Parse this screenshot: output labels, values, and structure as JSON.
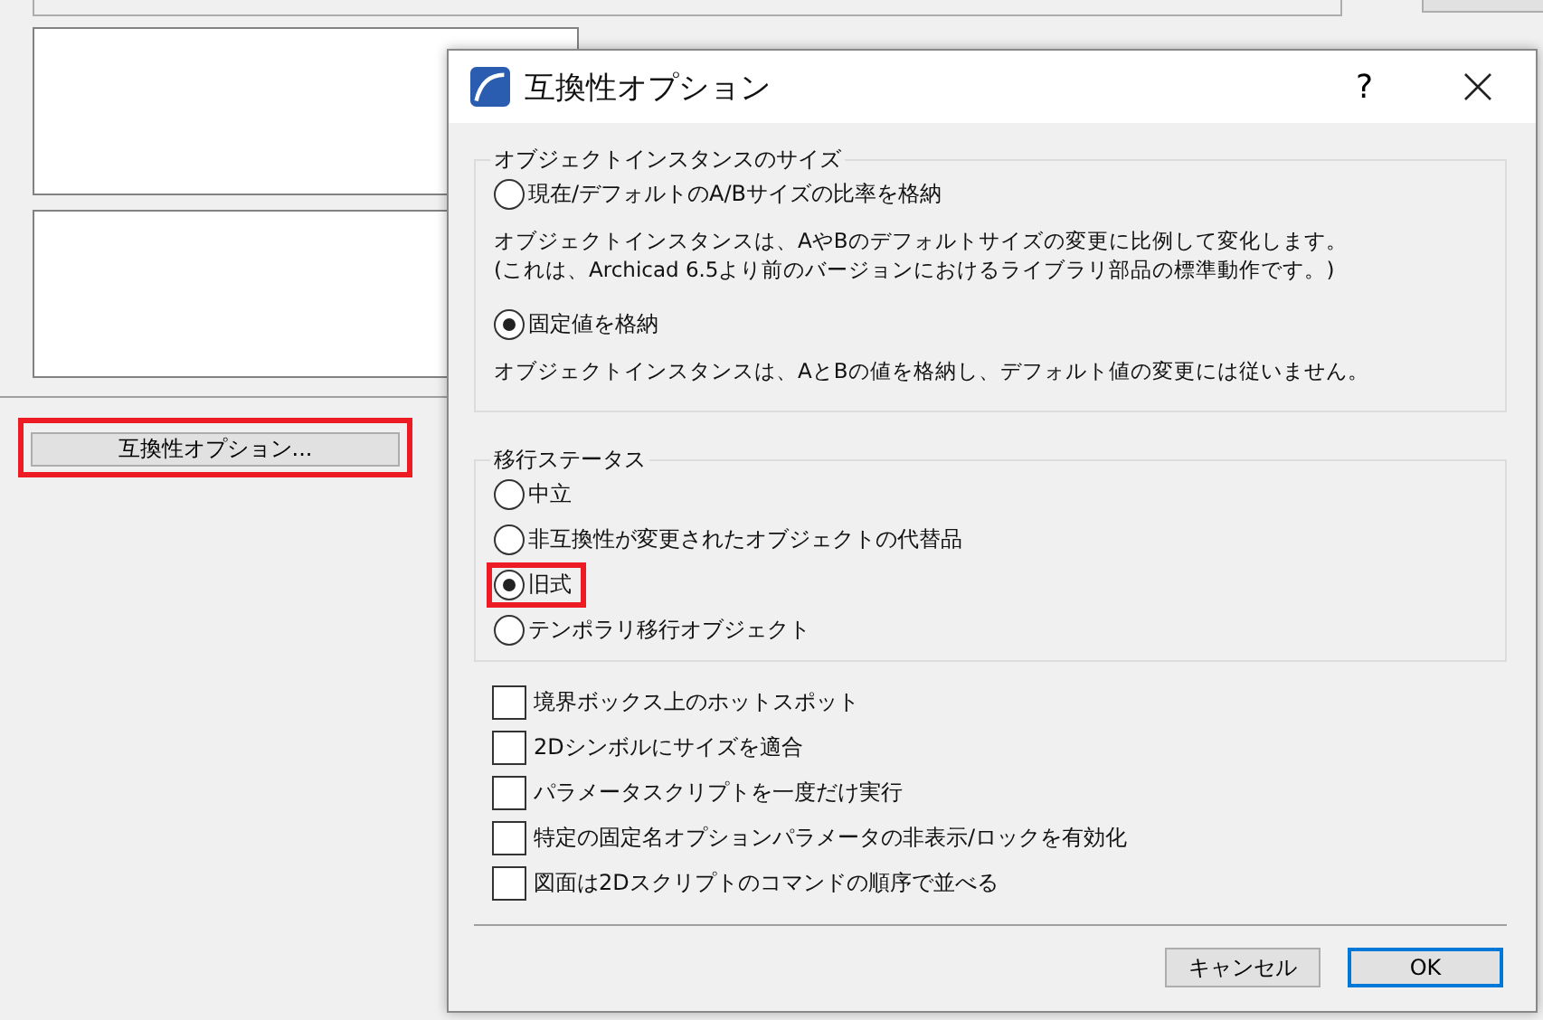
{
  "background": {
    "button": {
      "label": "互換性オプション...",
      "highlighted": true
    }
  },
  "dialog": {
    "title": "互換性オプション",
    "help": "?",
    "size_group": {
      "legend": "オブジェクトインスタンスのサイズ",
      "options": [
        {
          "label": "現在/デフォルトのA/Bサイズの比率を格納",
          "selected": false,
          "description": [
            "オブジェクトインスタンスは、AやBのデフォルトサイズの変更に比例して変化します。",
            "(これは、Archicad 6.5より前のバージョンにおけるライブラリ部品の標準動作です。)"
          ]
        },
        {
          "label": "固定値を格納",
          "selected": true,
          "description": [
            "オブジェクトインスタンスは、AとBの値を格納し、デフォルト値の変更には従いません。"
          ]
        }
      ]
    },
    "status_group": {
      "legend": "移行ステータス",
      "options": [
        {
          "label": "中立",
          "selected": false,
          "highlighted": false
        },
        {
          "label": "非互換性が変更されたオブジェクトの代替品",
          "selected": false,
          "highlighted": false
        },
        {
          "label": "旧式",
          "selected": true,
          "highlighted": true
        },
        {
          "label": "テンポラリ移行オブジェクト",
          "selected": false,
          "highlighted": false
        }
      ]
    },
    "checkboxes": [
      {
        "label": "境界ボックス上のホットスポット",
        "checked": false
      },
      {
        "label": "2Dシンボルにサイズを適合",
        "checked": false
      },
      {
        "label": "パラメータスクリプトを一度だけ実行",
        "checked": false
      },
      {
        "label": "特定の固定名オプションパラメータの非表示/ロックを有効化",
        "checked": false
      },
      {
        "label": "図面は2Dスクリプトのコマンドの順序で並べる",
        "checked": false
      }
    ],
    "buttons": [
      {
        "label": "キャンセル",
        "kind": "normal"
      },
      {
        "label": "OK",
        "kind": "default"
      }
    ]
  }
}
